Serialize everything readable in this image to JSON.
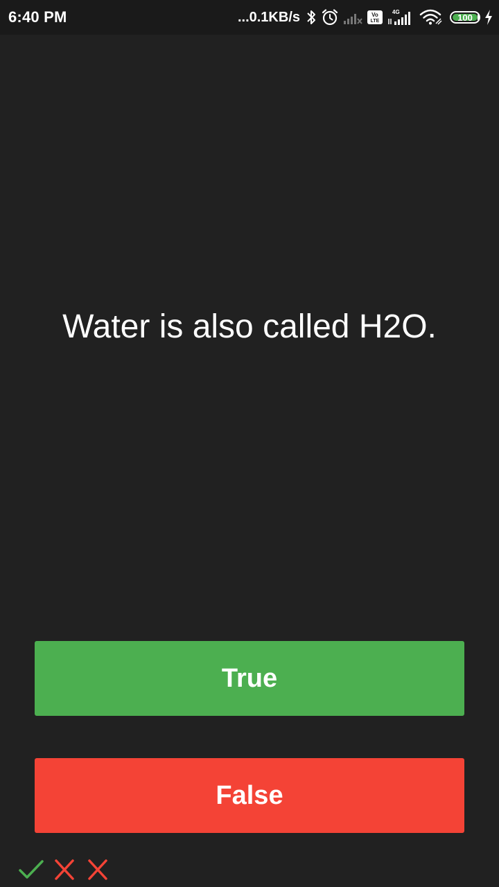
{
  "status_bar": {
    "time": "6:40 PM",
    "network_speed": "...0.1KB/s",
    "network_type": "4G",
    "volte_label": "Vo LTE",
    "battery_level": "100",
    "battery_percent": 100,
    "icons": [
      "bluetooth-icon",
      "alarm-icon",
      "signal-sim1-icon",
      "volte-icon",
      "signal-4g-icon",
      "wifi-icon",
      "battery-icon",
      "charging-icon"
    ]
  },
  "quiz": {
    "question": "Water is also called H2O.",
    "true_label": "True",
    "false_label": "False"
  },
  "score": {
    "results": [
      "correct",
      "wrong",
      "wrong"
    ]
  },
  "colors": {
    "background": "#212121",
    "status_bar": "#1a1a1a",
    "true_button": "#4caf50",
    "false_button": "#f44336",
    "correct_mark": "#4caf50",
    "wrong_mark": "#f44336",
    "battery_fill": "#4caf50"
  }
}
